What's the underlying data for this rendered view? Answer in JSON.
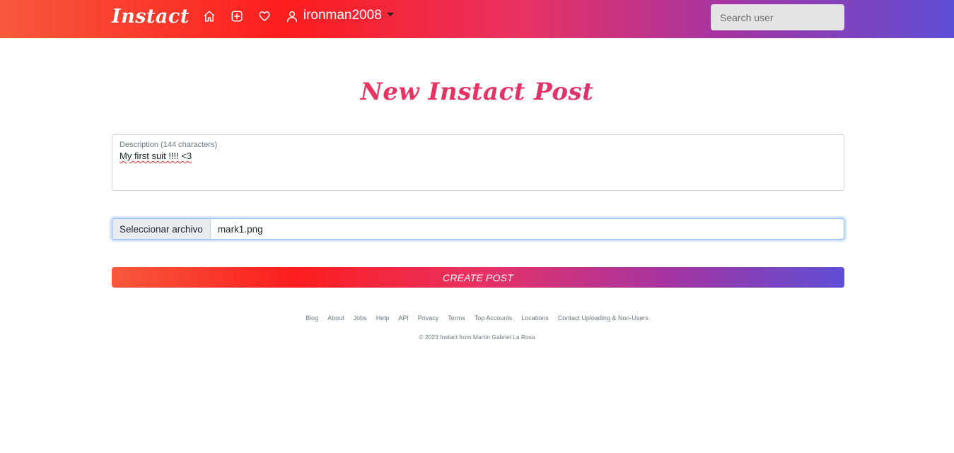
{
  "navbar": {
    "brand": "Instact",
    "icons": [
      "home-icon",
      "add-post-icon",
      "heart-icon",
      "user-icon"
    ],
    "username": "ironman2008",
    "search_placeholder": "Search user",
    "gradient": [
      "#f7593b",
      "#fd1d1d",
      "#e83263",
      "#a834a0",
      "#5f4fd6"
    ]
  },
  "main": {
    "title": "New Instact Post",
    "description": {
      "label": "Description (144 characters)",
      "value": "My first suit !!!! <3"
    },
    "file": {
      "button_label": "Seleccionar archivo",
      "file_name": "mark1.png"
    },
    "submit_label": "CREATE POST"
  },
  "footer": {
    "links": [
      "Blog",
      "About",
      "Jobs",
      "Help",
      "API",
      "Privacy",
      "Terms",
      "Top Accounts",
      "Locations",
      "Contact Uploading & Non-Users"
    ],
    "copyright": "© 2023 Instact from Martín Gabriel La Rosa"
  },
  "colors": {
    "title_pink": "#e83263",
    "focus_blue": "#86b7fe",
    "muted_text": "#6c757d"
  }
}
